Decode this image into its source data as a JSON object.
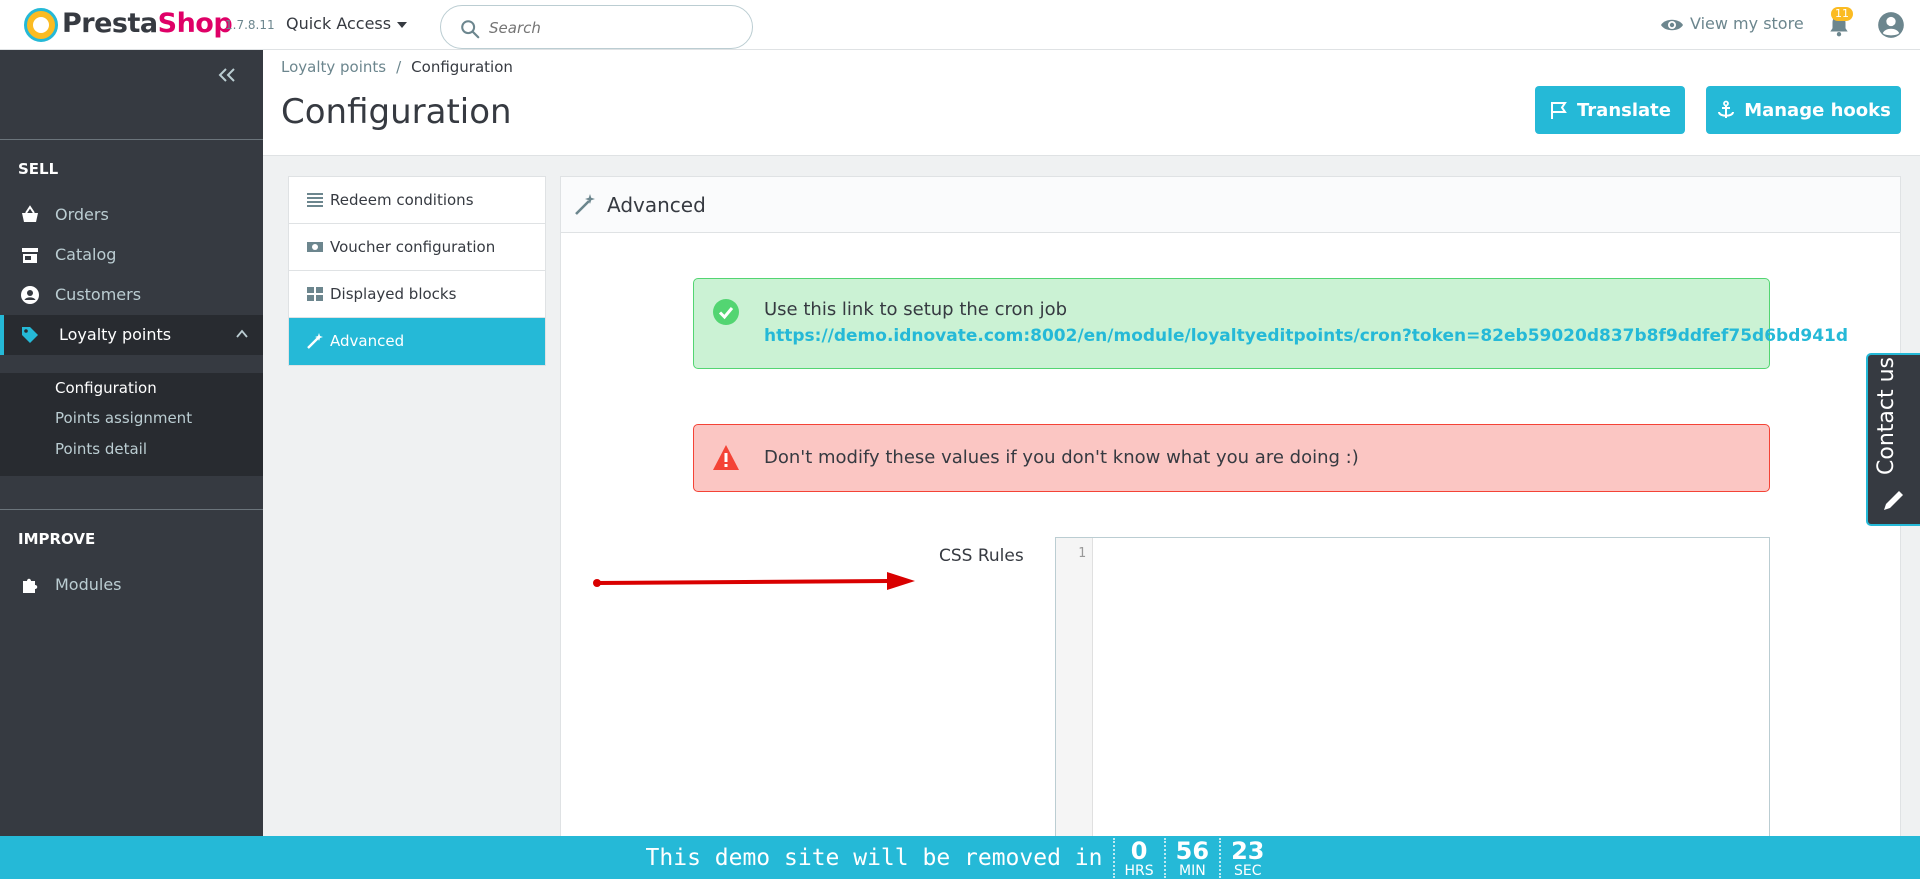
{
  "header": {
    "brand_presta": "Presta",
    "brand_shop": "Shop",
    "version": "1.7.8.11",
    "quick_access": "Quick Access",
    "search_placeholder": "Search",
    "view_store": "View my store",
    "notification_count": "11"
  },
  "sidebar": {
    "sell_title": "SELL",
    "orders": "Orders",
    "catalog": "Catalog",
    "customers": "Customers",
    "loyalty": "Loyalty points",
    "sub_configuration": "Configuration",
    "sub_points_assignment": "Points assignment",
    "sub_points_detail": "Points detail",
    "improve_title": "IMPROVE",
    "modules": "Modules"
  },
  "page": {
    "breadcrumb_parent": "Loyalty points",
    "breadcrumb_sep": "/",
    "breadcrumb_current": "Configuration",
    "title": "Configuration",
    "translate_label": "Translate",
    "manage_hooks_label": "Manage hooks"
  },
  "tabs": [
    {
      "label": "Redeem conditions",
      "icon": "list-icon"
    },
    {
      "label": "Voucher configuration",
      "icon": "money-icon"
    },
    {
      "label": "Displayed blocks",
      "icon": "grid-icon"
    },
    {
      "label": "Advanced",
      "icon": "magic-wand-icon"
    }
  ],
  "panel": {
    "title": "Advanced",
    "success_text": "Use this link to setup the cron job",
    "cron_link": "https://demo.idnovate.com:8002/en/module/loyaltyeditpoints/cron?token=82eb59020d837b8f9ddfef75d6bd941d",
    "danger_text": "Don't modify these values if you don't know what you are doing :)",
    "css_label": "CSS Rules",
    "line_number": "1"
  },
  "contact": {
    "label": "Contact us"
  },
  "demo_bar": {
    "message": "This demo site will be removed in",
    "hours": "0",
    "hours_unit": "HRS",
    "minutes": "56",
    "minutes_unit": "MIN",
    "seconds": "23",
    "seconds_unit": "SEC"
  },
  "colors": {
    "primary": "#25b9d7",
    "sidebar_bg": "#363a41",
    "brand_pink": "#df0067",
    "success_bg": "#cbf2d4",
    "danger_bg": "#fbc6c3",
    "arrow": "#d90000"
  }
}
